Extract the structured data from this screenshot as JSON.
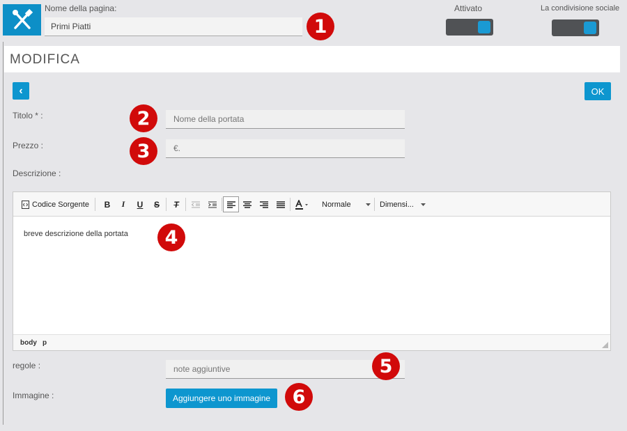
{
  "page": {
    "name_label": "Nome della pagina:",
    "name_value": "Primi Piatti",
    "enabled_label": "Attivato",
    "social_label": "La condivisione sociale"
  },
  "header": {
    "title": "MODIFICA"
  },
  "actions": {
    "back": "‹",
    "ok": "OK"
  },
  "form": {
    "title_label": "Titolo * :",
    "title_placeholder": "Nome della portata",
    "price_label": "Prezzo :",
    "price_placeholder": "€.",
    "description_label": "Descrizione :",
    "rules_label": "regole :",
    "rules_placeholder": "note aggiuntive",
    "image_label": "Immagine :",
    "image_button": "Aggiungere uno immagine"
  },
  "editor": {
    "source_label": "Codice Sorgente",
    "bold": "B",
    "italic": "I",
    "underline": "U",
    "strike": "S",
    "clear": "T",
    "format_select": "Normale",
    "size_select": "Dimensi...",
    "content": "breve descrizione della portata",
    "path_body": "body",
    "path_p": "p"
  },
  "callouts": [
    "1",
    "2",
    "3",
    "4",
    "5",
    "6"
  ],
  "colors": {
    "accent": "#0d96cf",
    "callout": "#d10a0a",
    "toggle_track": "#505255"
  }
}
